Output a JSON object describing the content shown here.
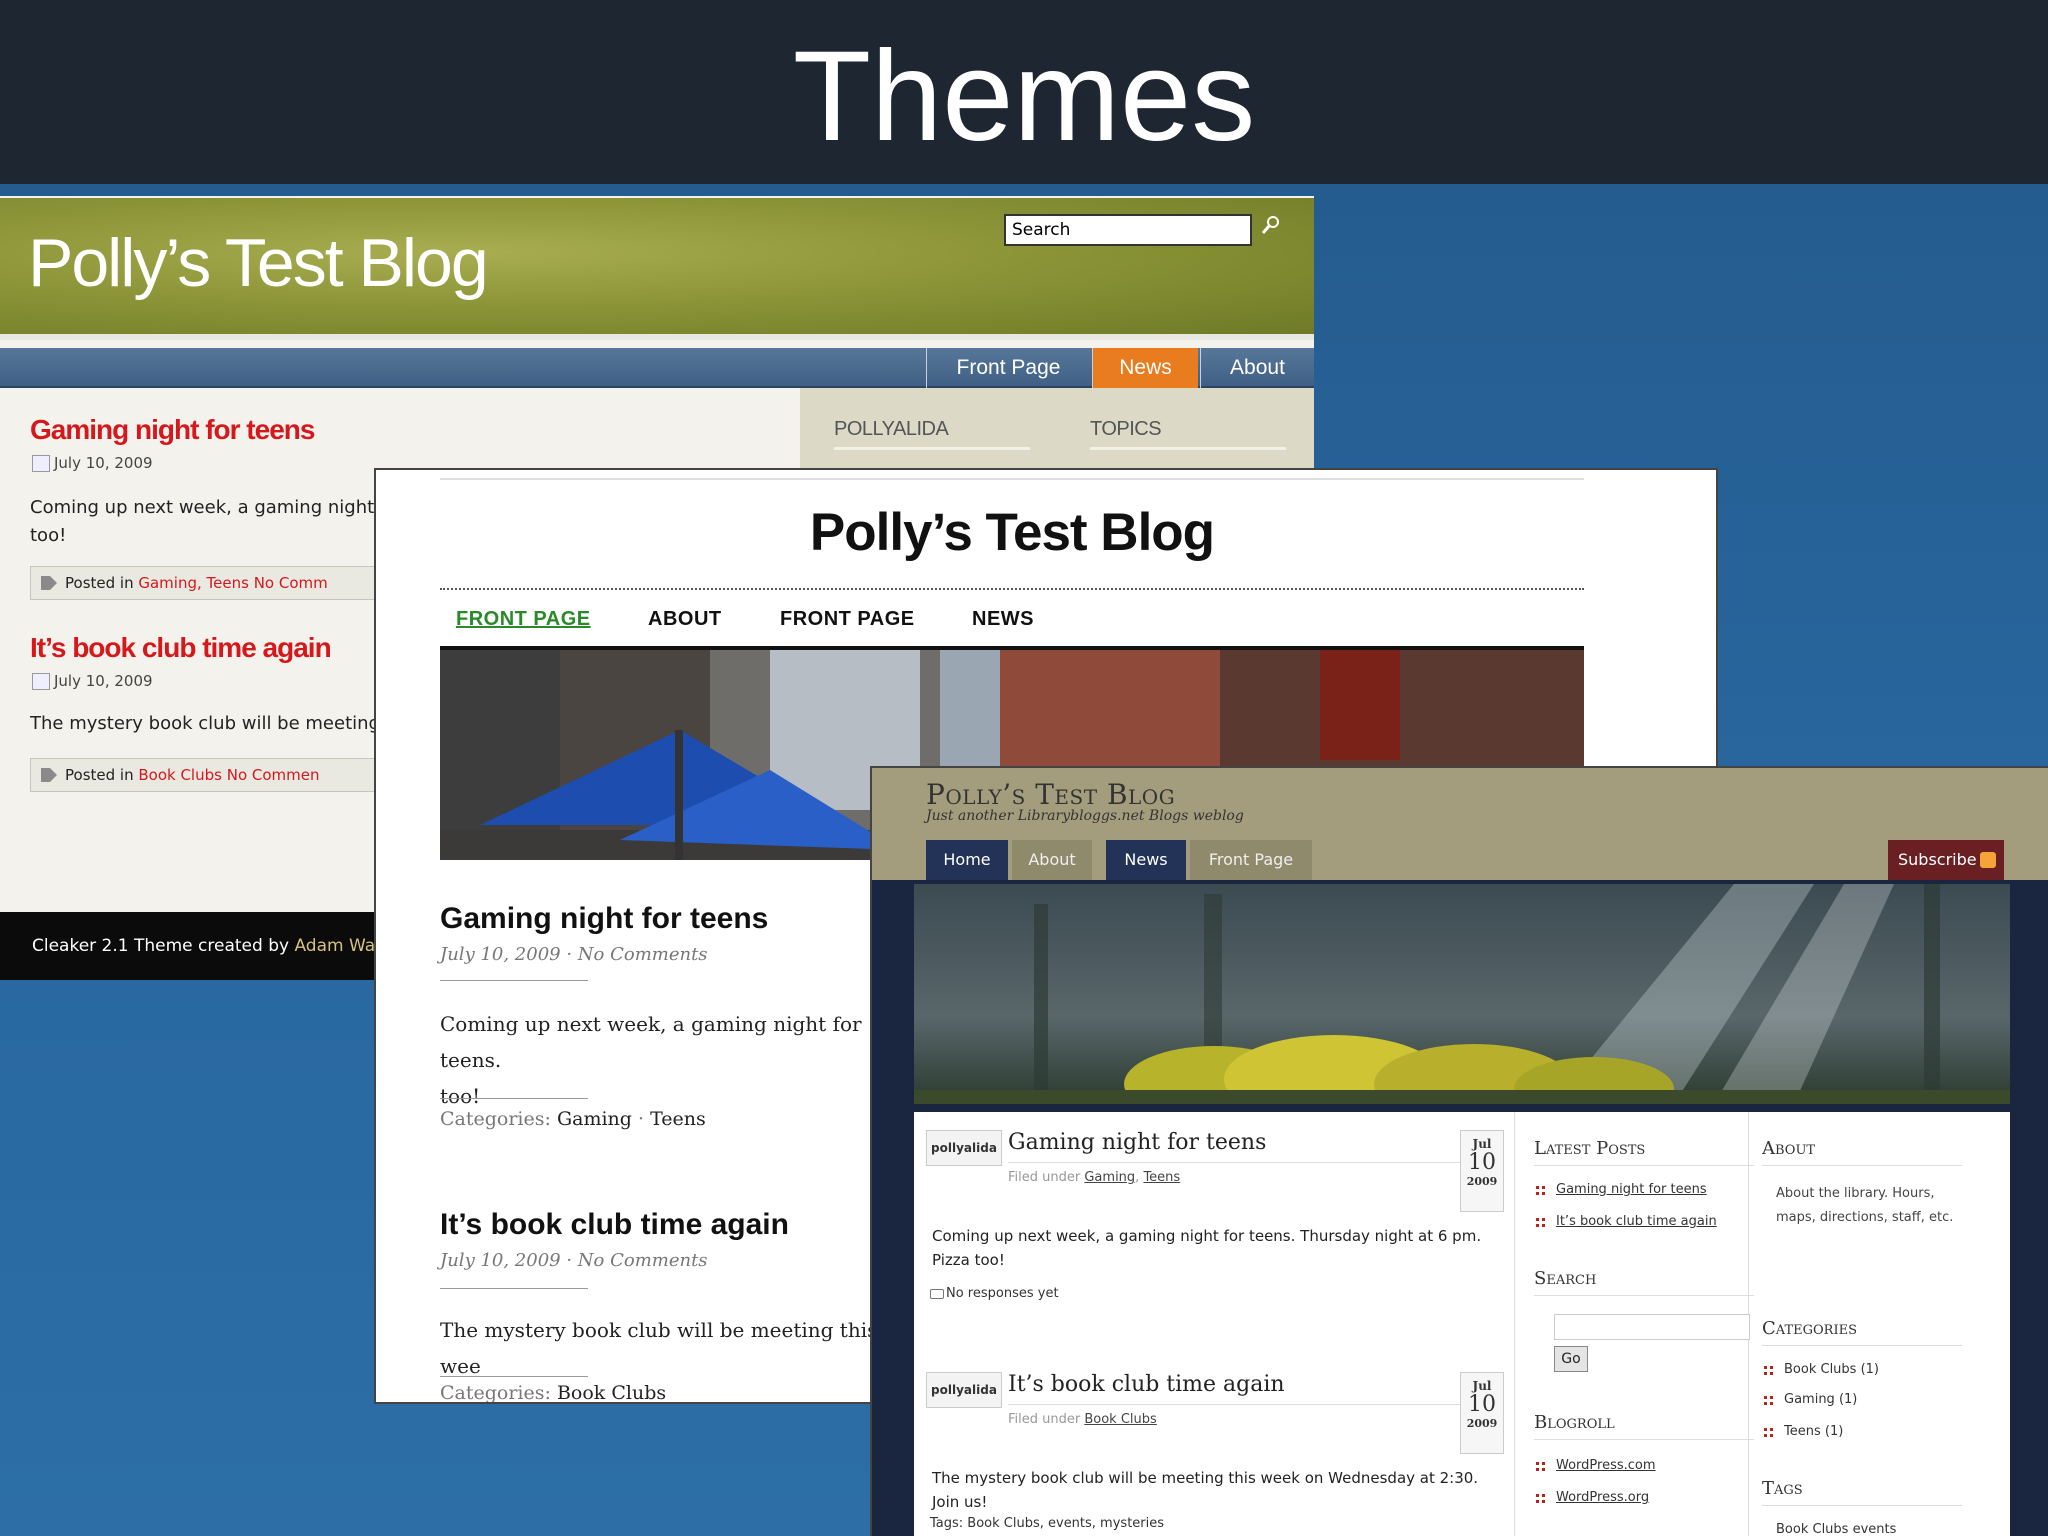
{
  "slide": {
    "title": "Themes"
  },
  "cleaker": {
    "blog_title": "Polly’s Test Blog",
    "search_placeholder": "Search",
    "nav": [
      "Front Page",
      "News",
      "About"
    ],
    "active_tab": "News",
    "sidebar_headings": [
      "POLLYALIDA",
      "TOPICS"
    ],
    "posts": [
      {
        "title": "Gaming night for teens",
        "date": "July 10, 2009",
        "excerpt": "Coming up next week, a gaming night",
        "excerpt_line2": "too!",
        "meta_prefix": "Posted in",
        "categories": "Gaming, Teens",
        "comments": "No Comm"
      },
      {
        "title": "It’s book club time again",
        "date": "July 10, 2009",
        "excerpt": "The mystery book club will be meeting",
        "meta_prefix": "Posted in",
        "categories": "Book Clubs",
        "comments": "No Commen"
      }
    ],
    "footer_text": "Cleaker 2.1 Theme created by",
    "footer_author": "Adam Wall"
  },
  "minimal": {
    "blog_title": "Polly’s Test Blog",
    "nav": [
      "FRONT PAGE",
      "ABOUT",
      "FRONT PAGE",
      "NEWS"
    ],
    "posts": [
      {
        "title": "Gaming night for teens",
        "date": "July 10, 2009 · No Comments",
        "body_line1": "Coming up next week, a gaming night for teens.",
        "body_line2": "too!",
        "categories_label": "Categories:",
        "categories": "Gaming",
        "categories_2": "Teens"
      },
      {
        "title": "It’s book club time again",
        "date": "July 10, 2009 · No Comments",
        "body_line1": "The mystery book club will be meeting this wee",
        "categories_label": "Categories:",
        "categories": "Book Clubs"
      }
    ]
  },
  "library": {
    "blog_title": "Polly’s Test Blog",
    "tagline": "Just another Librarybloggs.net Blogs weblog",
    "nav": [
      "Home",
      "About",
      "News",
      "Front Page"
    ],
    "subscribe": "Subscribe",
    "posts": [
      {
        "author": "pollyalida",
        "title": "Gaming night for teens",
        "filed_under": "Filed under",
        "categories": [
          "Gaming",
          "Teens"
        ],
        "month": "Jul",
        "day": "10",
        "year": "2009",
        "body": "Coming up next week, a gaming night for teens. Thursday night at 6 pm. Pizza too!",
        "responses": "No responses yet"
      },
      {
        "author": "pollyalida",
        "title": "It’s book club time again",
        "filed_under": "Filed under",
        "categories": [
          "Book Clubs"
        ],
        "month": "Jul",
        "day": "10",
        "year": "2009",
        "body": "The mystery book club will be meeting this week on Wednesday at 2:30. Join us!",
        "tags": "Tags: Book Clubs, events, mysteries"
      }
    ],
    "sidebar": {
      "latest_posts_heading": "Latest Posts",
      "latest_posts": [
        "Gaming night for teens",
        "It’s book club time again"
      ],
      "search_heading": "Search",
      "search_button": "Go",
      "blogroll_heading": "Blogroll",
      "blogroll": [
        "WordPress.com",
        "WordPress.org"
      ],
      "about_heading": "About",
      "about_text": "About the library. Hours, maps, directions, staff, etc.",
      "categories_heading": "Categories",
      "categories": [
        "Book Clubs (1)",
        "Gaming (1)",
        "Teens (1)"
      ],
      "tags_heading": "Tags",
      "tags_text": "Book Clubs events"
    }
  },
  "colors": {
    "slide_bg": "#2a629a",
    "title_bar": "#1d2631",
    "cleaker_red": "#d6181d",
    "cleaker_active_tab": "#e87c1e",
    "minimal_active_nav": "#2a8a2a"
  }
}
